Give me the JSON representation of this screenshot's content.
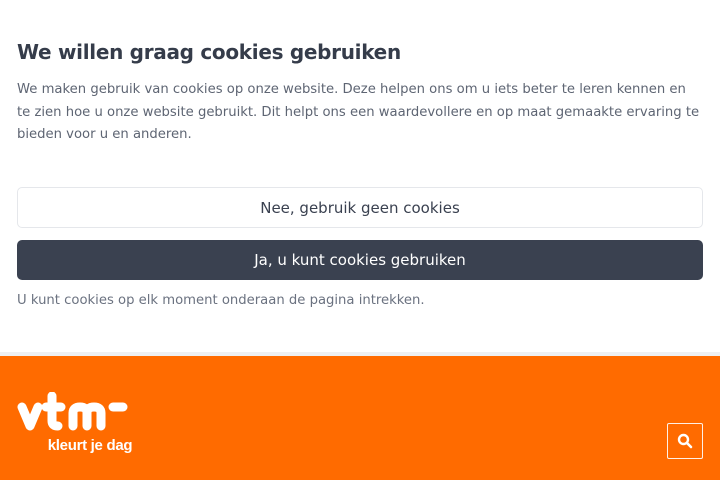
{
  "consent": {
    "title": "We willen graag cookies gebruiken",
    "body": "We maken gebruik van cookies op onze website. Deze helpen ons om u iets beter te leren kennen en te zien hoe u onze website gebruikt. Dit helpt ons een waardevollere en op maat gemaakte ervaring te bieden voor u en anderen.",
    "decline_label": "Nee, gebruik geen cookies",
    "accept_label": "Ja, u kunt cookies gebruiken",
    "note": "U kunt cookies op elk moment onderaan de pagina intrekken."
  },
  "header": {
    "logo_text": "vtm",
    "tagline": "kleurt je dag",
    "search_icon": "search-icon"
  },
  "colors": {
    "brand_orange": "#ff6b00",
    "accept_button": "#3a4150",
    "text_dark": "#353c4a"
  }
}
